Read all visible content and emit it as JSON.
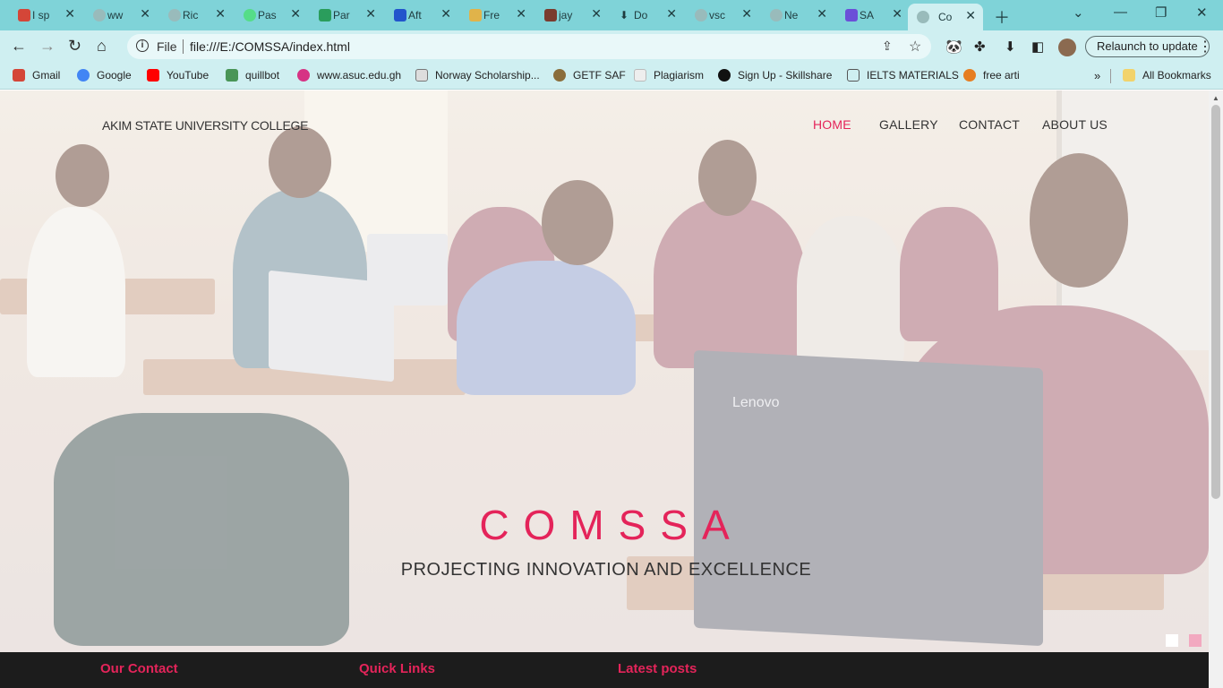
{
  "browser": {
    "tabs": [
      {
        "title": "I sp",
        "icon": "gmail-icon",
        "color": "#d44638"
      },
      {
        "title": "ww",
        "icon": "globe-icon",
        "color": "#9bb"
      },
      {
        "title": "Ric",
        "icon": "globe-icon",
        "color": "#9bb"
      },
      {
        "title": "Pas",
        "icon": "chatgpt-icon",
        "color": "#5d8"
      },
      {
        "title": "Par",
        "icon": "robot-icon",
        "color": "#2a9d5c"
      },
      {
        "title": "Aft",
        "icon": "bookmark-icon",
        "color": "#2255cc"
      },
      {
        "title": "Fre",
        "icon": "certificate-icon",
        "color": "#e0b34a"
      },
      {
        "title": "jay",
        "icon": "figure-icon",
        "color": "#7a3b2e"
      },
      {
        "title": "Do",
        "icon": "download-icon",
        "color": "#222"
      },
      {
        "title": "vsc",
        "icon": "globe-icon",
        "color": "#9bb"
      },
      {
        "title": "Ne",
        "icon": "globe-icon",
        "color": "#9bb"
      },
      {
        "title": "SA",
        "icon": "vite-icon",
        "color": "#6b4fd8"
      },
      {
        "title": "Co",
        "icon": "globe-icon",
        "color": "#9bb",
        "active": true
      }
    ],
    "url_scheme": "File",
    "url": "file:///E:/COMSSA/index.html",
    "relaunch_label": "Relaunch to update",
    "bookmarks": [
      {
        "label": "Gmail",
        "icon": "gmail-icon",
        "color": "#d44638"
      },
      {
        "label": "Google",
        "icon": "google-icon",
        "color": "#4285f4"
      },
      {
        "label": "YouTube",
        "icon": "youtube-icon",
        "color": "#ff0000"
      },
      {
        "label": "quillbot",
        "icon": "quillbot-icon",
        "color": "#499557"
      },
      {
        "label": "www.asuc.edu.gh",
        "icon": "asuc-icon",
        "color": "#d63384"
      },
      {
        "label": "Norway Scholarship...",
        "icon": "page-icon",
        "color": "#777"
      },
      {
        "label": "GETF SAF",
        "icon": "getf-icon",
        "color": "#8a6d3b"
      },
      {
        "label": "Plagiarism",
        "icon": "sst-icon",
        "color": "#bbb"
      },
      {
        "label": "Sign Up - Skillshare",
        "icon": "skillshare-icon",
        "color": "#111"
      },
      {
        "label": "IELTS MATERIALS",
        "icon": "book-icon",
        "color": "#555"
      },
      {
        "label": "free arti",
        "icon": "eye-icon",
        "color": "#e67e22"
      }
    ],
    "all_bookmarks_label": "All Bookmarks"
  },
  "site": {
    "brand": "AKIM STATE UNIVERSITY COLLEGE",
    "nav": [
      "HOME",
      "GALLERY",
      "CONTACT",
      "ABOUT US"
    ],
    "nav_active_index": 0,
    "hero_title": "COMSSA",
    "hero_subtitle": "PROJECTING INNOVATION AND EXCELLENCE",
    "photo_label": "Lenovo",
    "footer_headings": [
      "Our Contact",
      "Quick Links",
      "Latest posts"
    ]
  },
  "colors": {
    "accent": "#e4245a",
    "footer_bg": "#1c1c1c",
    "tabbar_bg": "#7fd3d8"
  }
}
